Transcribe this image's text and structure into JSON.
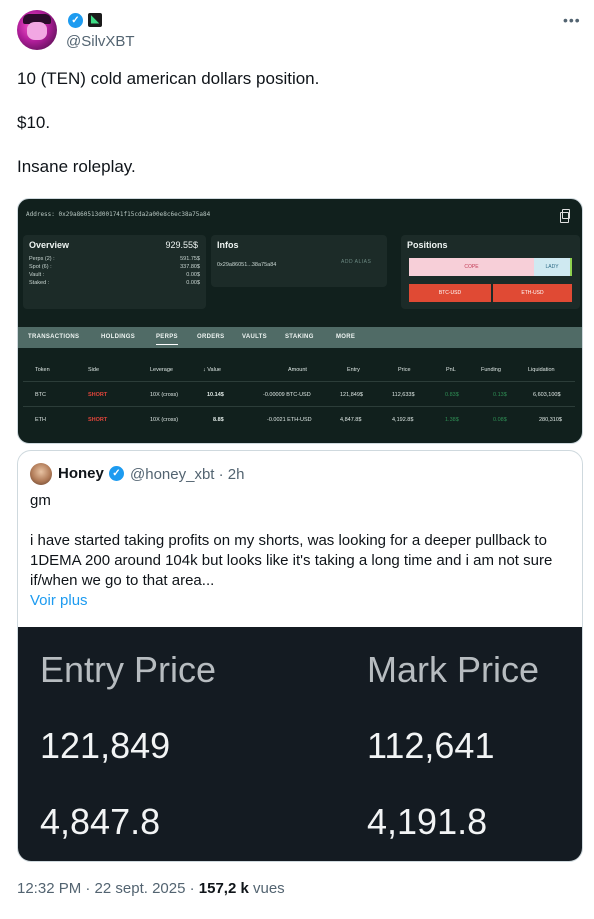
{
  "author": {
    "handle": "@SilvXBT"
  },
  "tweet": {
    "lines": [
      "10 (TEN) cold american dollars position.",
      "$10.",
      "Insane roleplay."
    ]
  },
  "screenshot": {
    "address": "Address: 0x29a860513d001741f15cda2a00e8c6ec38a75a84",
    "overview": {
      "title": "Overview",
      "total": "929.55$",
      "rows": [
        {
          "label": "Perps (2) :",
          "value": "591.75$"
        },
        {
          "label": "Spot (6) :",
          "value": "337.80$"
        },
        {
          "label": "Vault :",
          "value": "0.00$"
        },
        {
          "label": "Staked :",
          "value": "0.00$"
        }
      ]
    },
    "infos": {
      "title": "Infos",
      "address_short": "0x29a86051...38a75a84",
      "alias_button": "ADD ALIAS"
    },
    "positions": {
      "title": "Positions",
      "cope": "COPE",
      "lady": "LADY",
      "btc_button": "BTC-USD",
      "eth_button": "ETH-USD"
    },
    "tabs": [
      "TRANSACTIONS",
      "HOLDINGS",
      "PERPS",
      "ORDERS",
      "VAULTS",
      "STAKING",
      "MORE"
    ],
    "active_tab": "PERPS",
    "table": {
      "headers": [
        "Token",
        "Side",
        "Leverage",
        "↓ Value",
        "Amount",
        "Entry",
        "Price",
        "PnL",
        "Funding",
        "Liquidation"
      ],
      "rows": [
        [
          "BTC",
          "SHORT",
          "10X (cross)",
          "10.14$",
          "-0.00009 BTC-USD",
          "121,849$",
          "112,633$",
          "0.83$",
          "0.13$",
          "6,603,100$"
        ],
        [
          "ETH",
          "SHORT",
          "10X (cross)",
          "8.8$",
          "-0.0021 ETH-USD",
          "4,847.8$",
          "4,192.8$",
          "1.38$",
          "0.08$",
          "280,310$"
        ]
      ],
      "colors": {
        "short": "#e0453b",
        "pnl": "#2f8f55"
      }
    }
  },
  "quote": {
    "name": "Honey",
    "handle_time": "@honey_xbt · 2h",
    "paragraphs": [
      "gm",
      "i have started taking profits on my shorts, was looking for a deeper pullback to 1DEMA 200 around 104k but looks like it's taking a long time and i am not sure if/when we go to that area..."
    ],
    "more_link": "Voir plus",
    "image": {
      "entry_header": "Entry Price",
      "mark_header": "Mark Price",
      "entry_values": [
        "121,849",
        "4,847.8"
      ],
      "mark_values": [
        "112,641",
        "4,191.8"
      ]
    }
  },
  "meta": {
    "time_date": "12:32 PM · 22 sept. 2025 · ",
    "views_count": "157,2 k",
    "views_label": " vues"
  }
}
